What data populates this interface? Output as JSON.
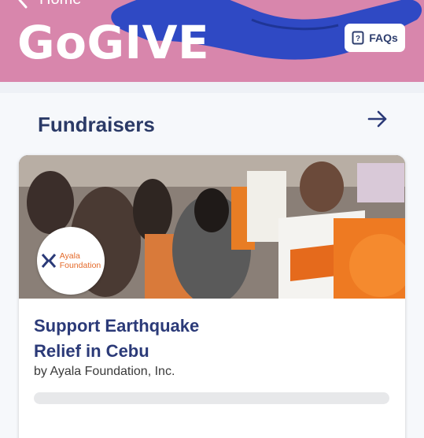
{
  "header": {
    "back_label": "Home",
    "brand": "GoGIVE",
    "faqs_label": "FAQs",
    "bg_color": "#d886ac"
  },
  "section": {
    "title": "Fundraisers"
  },
  "card": {
    "title_line1": "Support Earthquake",
    "title_line2": "Relief in Cebu",
    "organizer": "by Ayala Foundation, Inc.",
    "badge_line1": "Ayala",
    "badge_line2": "Foundation",
    "progress_fraction": 0,
    "accent_color": "#e46a2a"
  },
  "icons": {
    "back": "chevron-left-icon",
    "faqs": "question-book-icon",
    "arrow": "arrow-right-icon"
  }
}
